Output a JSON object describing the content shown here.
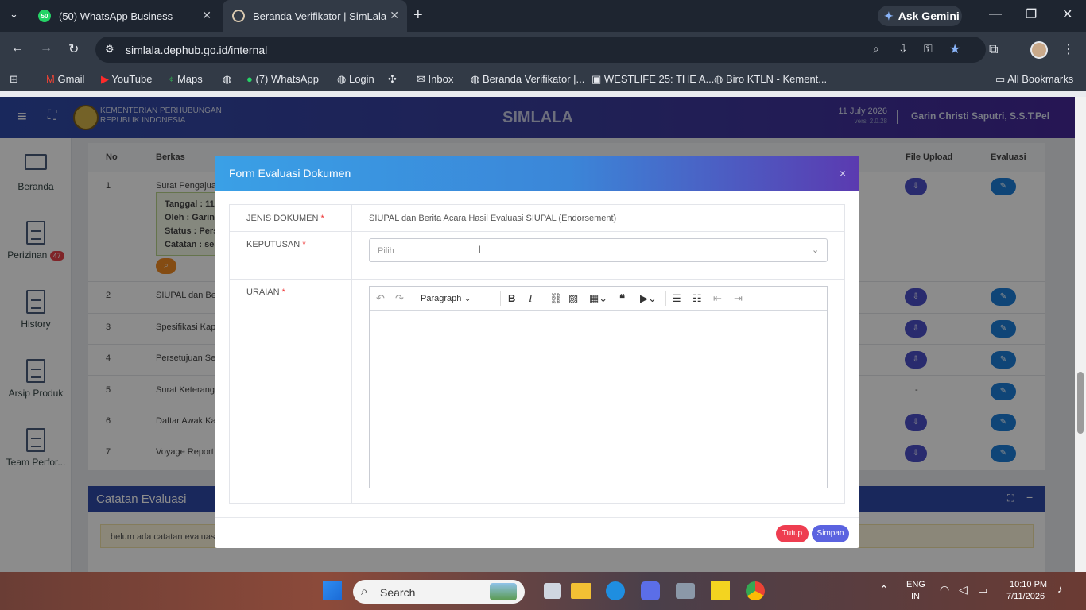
{
  "browser": {
    "tabs": [
      {
        "label": "(50) WhatsApp Business",
        "badge": "50"
      },
      {
        "label": "Beranda Verifikator | SimLala"
      }
    ],
    "url": "simlala.dephub.go.id/internal",
    "ask_gemini": "Ask Gemini",
    "bookmarks": [
      "Gmail",
      "YouTube",
      "Maps",
      "(7) WhatsApp",
      "Login",
      "Inbox",
      "Beranda Verifikator |...",
      "WESTLIFE 25: THE A...",
      "Biro KTLN - Kement..."
    ],
    "all_bookmarks": "All Bookmarks"
  },
  "app": {
    "org_line1": "KEMENTERIAN PERHUBUNGAN",
    "org_line2": "REPUBLIK INDONESIA",
    "title": "SIMLALA",
    "date": "11 July 2026",
    "version": "versi 2.0.28",
    "user": "Garin Christi Saputri, S.S.T.Pel"
  },
  "sidebar": {
    "items": [
      {
        "label": "Beranda"
      },
      {
        "label": "Perizinan",
        "badge": "47"
      },
      {
        "label": "History"
      },
      {
        "label": "Arsip Produk"
      },
      {
        "label": "Team Perfor..."
      }
    ]
  },
  "table": {
    "headers": {
      "no": "No",
      "berkas": "Berkas",
      "file_upload": "File Upload",
      "evaluasi": "Evaluasi"
    },
    "rows": [
      {
        "no": "1",
        "berkas": "Surat Pengajuan"
      },
      {
        "no": "2",
        "berkas": "SIUPAL dan Beri"
      },
      {
        "no": "3",
        "berkas": "Spesifikasi Kapa"
      },
      {
        "no": "4",
        "berkas": "Persetujuan Seb"
      },
      {
        "no": "5",
        "berkas": "Surat Keterangan",
        "upload": "-"
      },
      {
        "no": "6",
        "berkas": "Daftar Awak Kap"
      },
      {
        "no": "7",
        "berkas": "Voyage Report ("
      }
    ],
    "detail": {
      "tanggal": "Tanggal : 11",
      "oleh": "Oleh : Garin",
      "status": "Status : Perse",
      "catatan": "Catatan : ses"
    }
  },
  "catatan": {
    "title": "Catatan Evaluasi",
    "empty_text": "belum ada catatan evaluasi"
  },
  "modal": {
    "title": "Form Evaluasi Dokumen",
    "close": "×",
    "jenis_label": "JENIS DOKUMEN",
    "jenis_value": "SIUPAL dan Berita Acara Hasil Evaluasi SIUPAL (Endorsement)",
    "keputusan_label": "KEPUTUSAN",
    "keputusan_placeholder": "Pilih",
    "uraian_label": "URAIAN",
    "required_mark": "*",
    "editor_format": "Paragraph",
    "btn_tutup": "Tutup",
    "btn_simpan": "Simpan"
  },
  "taskbar": {
    "search_placeholder": "Search",
    "lang1": "ENG",
    "lang2": "IN",
    "time": "10:10 PM",
    "date": "7/11/2026"
  }
}
